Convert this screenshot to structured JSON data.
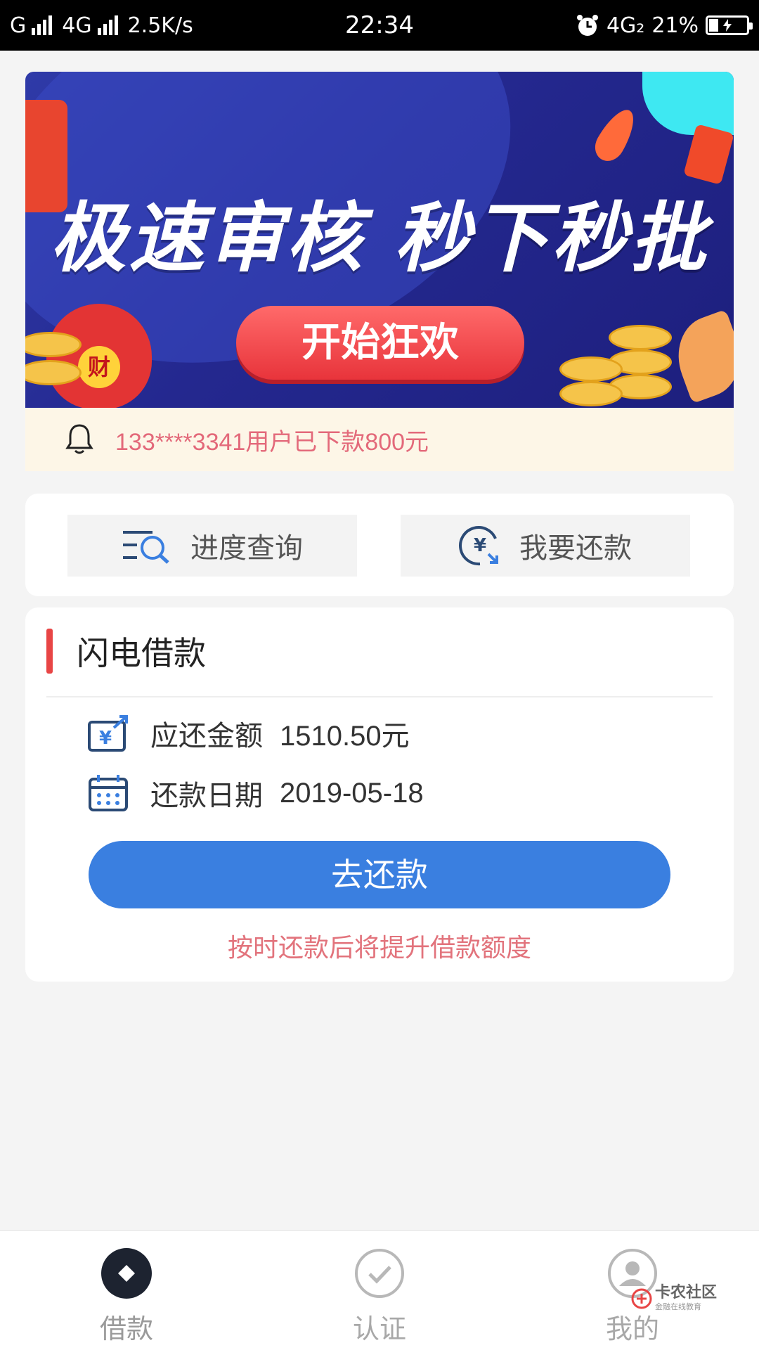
{
  "status_bar": {
    "carrier1": "G",
    "carrier2": "4G",
    "speed": "2.5K/s",
    "time": "22:34",
    "network": "4G₂",
    "battery": "21%"
  },
  "banner": {
    "title": "极速审核 秒下秒批",
    "button": "开始狂欢",
    "bag_char": "财"
  },
  "notice": {
    "text": "133****3341用户已下款800元"
  },
  "actions": {
    "progress": "进度查询",
    "repay": "我要还款"
  },
  "loan": {
    "title": "闪电借款",
    "amount_label": "应还金额",
    "amount_value": "1510.50元",
    "date_label": "还款日期",
    "date_value": "2019-05-18",
    "button": "去还款",
    "tip": "按时还款后将提升借款额度"
  },
  "tabs": [
    {
      "label": "借款",
      "icon": "diamond-icon"
    },
    {
      "label": "认证",
      "icon": "check-icon"
    },
    {
      "label": "我的",
      "icon": "user-icon"
    }
  ],
  "watermark": {
    "name": "卡农社区",
    "sub": "金融在线教育"
  },
  "colors": {
    "primary": "#3a7fe0",
    "accent_red": "#e84545",
    "notice_text": "#e3697a"
  }
}
